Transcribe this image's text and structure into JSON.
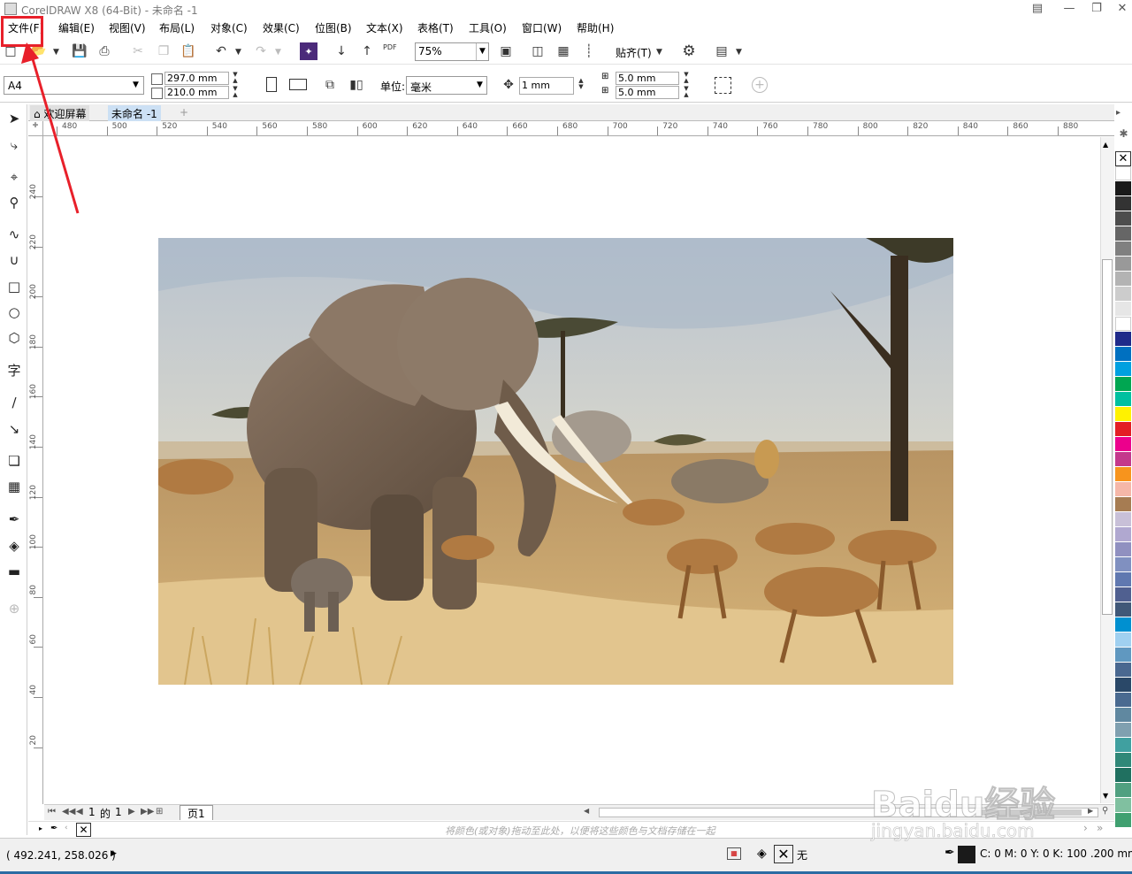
{
  "window": {
    "title": "CorelDRAW X8 (64-Bit) - 未命名 -1",
    "controls": [
      "restore-down",
      "minimize",
      "maximize",
      "close"
    ]
  },
  "menu": [
    {
      "label": "文件(F)",
      "highlighted": true
    },
    {
      "label": "编辑(E)"
    },
    {
      "label": "视图(V)"
    },
    {
      "label": "布局(L)"
    },
    {
      "label": "对象(C)"
    },
    {
      "label": "效果(C)"
    },
    {
      "label": "位图(B)"
    },
    {
      "label": "文本(X)"
    },
    {
      "label": "表格(T)"
    },
    {
      "label": "工具(O)"
    },
    {
      "label": "窗口(W)"
    },
    {
      "label": "帮助(H)"
    }
  ],
  "standard_toolbar": {
    "zoom_value": "75%",
    "snap_label": "贴齐(T)",
    "pdf_label": "PDF"
  },
  "property_bar": {
    "page_size": "A4",
    "width": "297.0 mm",
    "height": "210.0 mm",
    "unit_label": "单位:",
    "unit_value": "毫米",
    "nudge": "1 mm",
    "dup_x": "5.0 mm",
    "dup_y": "5.0 mm"
  },
  "tabs": [
    {
      "label": "欢迎屏幕",
      "active": false
    },
    {
      "label": "未命名 -1",
      "active": true
    }
  ],
  "rulers": {
    "h_labels": [
      "480",
      "500",
      "520",
      "540",
      "560",
      "580",
      "600",
      "620",
      "640",
      "660",
      "680",
      "700",
      "720",
      "740",
      "760",
      "780",
      "800",
      "820",
      "840",
      "860",
      "880"
    ],
    "v_labels": [
      "240",
      "220",
      "200",
      "180",
      "160",
      "140",
      "120",
      "100",
      "80",
      "60",
      "40",
      "20"
    ]
  },
  "page_nav": {
    "current": "1",
    "of_label": "的",
    "total": "1",
    "page_tab": "页1"
  },
  "palette_hint": "将颜色(或对象)拖动至此处，以便将这些颜色与文档存储在一起",
  "status": {
    "coords": "( 492.241, 258.026 )",
    "fill_label": "无",
    "outline_info": "C: 0 M: 0 Y: 0 K: 100  .200 mm"
  },
  "palette_colors": [
    "#ffffff",
    "#1a1a1a",
    "#333333",
    "#4d4d4d",
    "#666666",
    "#808080",
    "#999999",
    "#b3b3b3",
    "#cccccc",
    "#e6e6e6",
    "#ffffff",
    "#1f2a8a",
    "#0070c0",
    "#00a0e0",
    "#00a651",
    "#00c0a0",
    "#fff200",
    "#e31e24",
    "#ec008c",
    "#c4388c",
    "#f7941d",
    "#f5b7a8",
    "#a67c52",
    "#c8c0d8",
    "#b0a8d0",
    "#9090c0",
    "#8090c0",
    "#6078b0",
    "#506090",
    "#405878",
    "#0090d0",
    "#a0d0f0",
    "#6098c0",
    "#4a6890",
    "#2a4868",
    "#4a6a90",
    "#6088a0",
    "#80a0b0",
    "#40a0a0",
    "#308878",
    "#207060",
    "#50a080",
    "#80c0a0",
    "#40a070"
  ],
  "watermark": {
    "text1": "Baidu经验",
    "text2": "jingyan.baidu.com"
  }
}
